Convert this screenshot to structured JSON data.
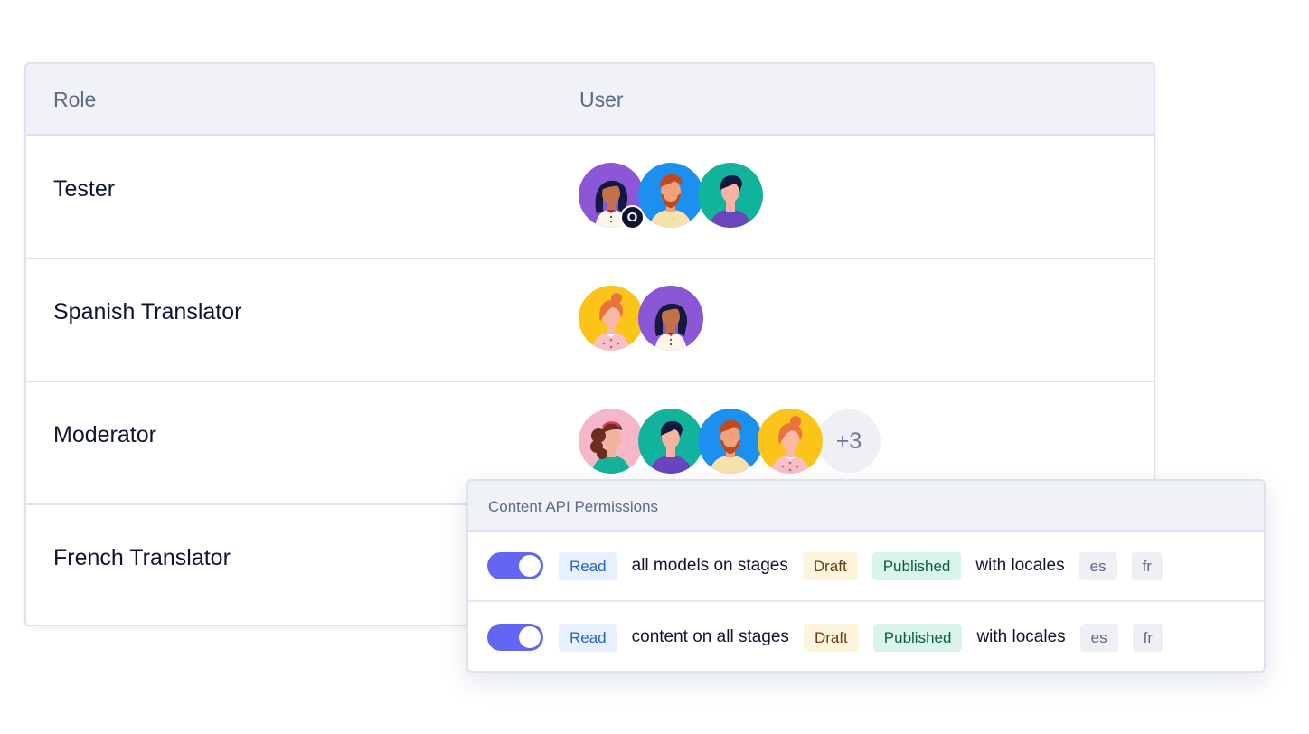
{
  "table": {
    "headers": {
      "role": "Role",
      "user": "User"
    },
    "rows": [
      {
        "role": "Tester",
        "avatars": [
          "woman-dark-hair-purple",
          "man-beard-blue",
          "man-dark-hair-teal"
        ],
        "badge": "O",
        "more": ""
      },
      {
        "role": "Spanish Translator",
        "avatars": [
          "woman-bun-yellow",
          "woman-dark-hair-purple"
        ],
        "badge": "",
        "more": ""
      },
      {
        "role": "Moderator",
        "avatars": [
          "woman-curly-pink",
          "man-dark-hair-teal",
          "man-beard-blue",
          "woman-bun-yellow"
        ],
        "badge": "",
        "more": "+3"
      },
      {
        "role": "French Translator",
        "avatars": [],
        "badge": "",
        "more": ""
      }
    ]
  },
  "permissions": {
    "title": "Content API Permissions",
    "rows": [
      {
        "enabled": true,
        "action": "Read",
        "text": "all models on stages",
        "stages": [
          "Draft",
          "Published"
        ],
        "locales_text": "with locales",
        "locales": [
          "es",
          "fr"
        ]
      },
      {
        "enabled": true,
        "action": "Read",
        "text": "content on all stages",
        "stages": [
          "Draft",
          "Published"
        ],
        "locales_text": "with locales",
        "locales": [
          "es",
          "fr"
        ]
      }
    ]
  },
  "colors": {
    "toggle_on": "#6366f1",
    "read_chip": "#e8f1ff",
    "draft_chip": "#fdf6dc",
    "published_chip": "#d9f4ea"
  }
}
